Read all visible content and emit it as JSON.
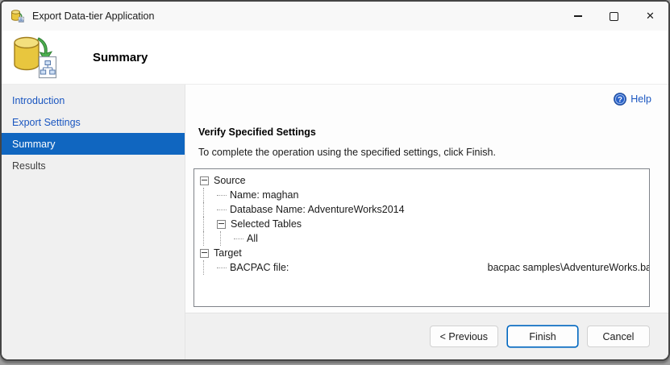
{
  "window": {
    "title": "Export Data-tier Application",
    "controls": [
      {
        "name": "minimize"
      },
      {
        "name": "maximize"
      },
      {
        "name": "close"
      }
    ]
  },
  "header": {
    "title": "Summary"
  },
  "sidebar": {
    "items": [
      {
        "label": "Introduction",
        "state": "link"
      },
      {
        "label": "Export Settings",
        "state": "link"
      },
      {
        "label": "Summary",
        "state": "selected"
      },
      {
        "label": "Results",
        "state": "plain"
      }
    ]
  },
  "main": {
    "help_label": "Help",
    "heading": "Verify Specified Settings",
    "description": "To complete the operation using the specified settings, click Finish.",
    "tree": [
      {
        "label": "Source",
        "depth": 0,
        "expand": true
      },
      {
        "label": "Name: maghan",
        "depth": 1
      },
      {
        "label": "Database Name: AdventureWorks2014",
        "depth": 1
      },
      {
        "label": "Selected Tables",
        "depth": 1,
        "expand": true
      },
      {
        "label": "All",
        "depth": 2
      },
      {
        "label": "Target",
        "depth": 0,
        "expand": true
      },
      {
        "label": "BACPAC file:",
        "depth": 1,
        "value_right": "bacpac samples\\AdventureWorks.ba"
      }
    ]
  },
  "footer": {
    "buttons": [
      {
        "label": "< Previous",
        "default": false
      },
      {
        "label": "Finish",
        "default": true
      },
      {
        "label": "Cancel",
        "default": false
      }
    ]
  },
  "colors": {
    "selected_item_bg": "#1066c0",
    "link_blue": "#1a56c0",
    "default_button_border": "#0067c0",
    "sidebar_bg": "#f0f0f0",
    "database_icon_gold": "#e8c63e",
    "arrow_green": "#4caf50"
  }
}
